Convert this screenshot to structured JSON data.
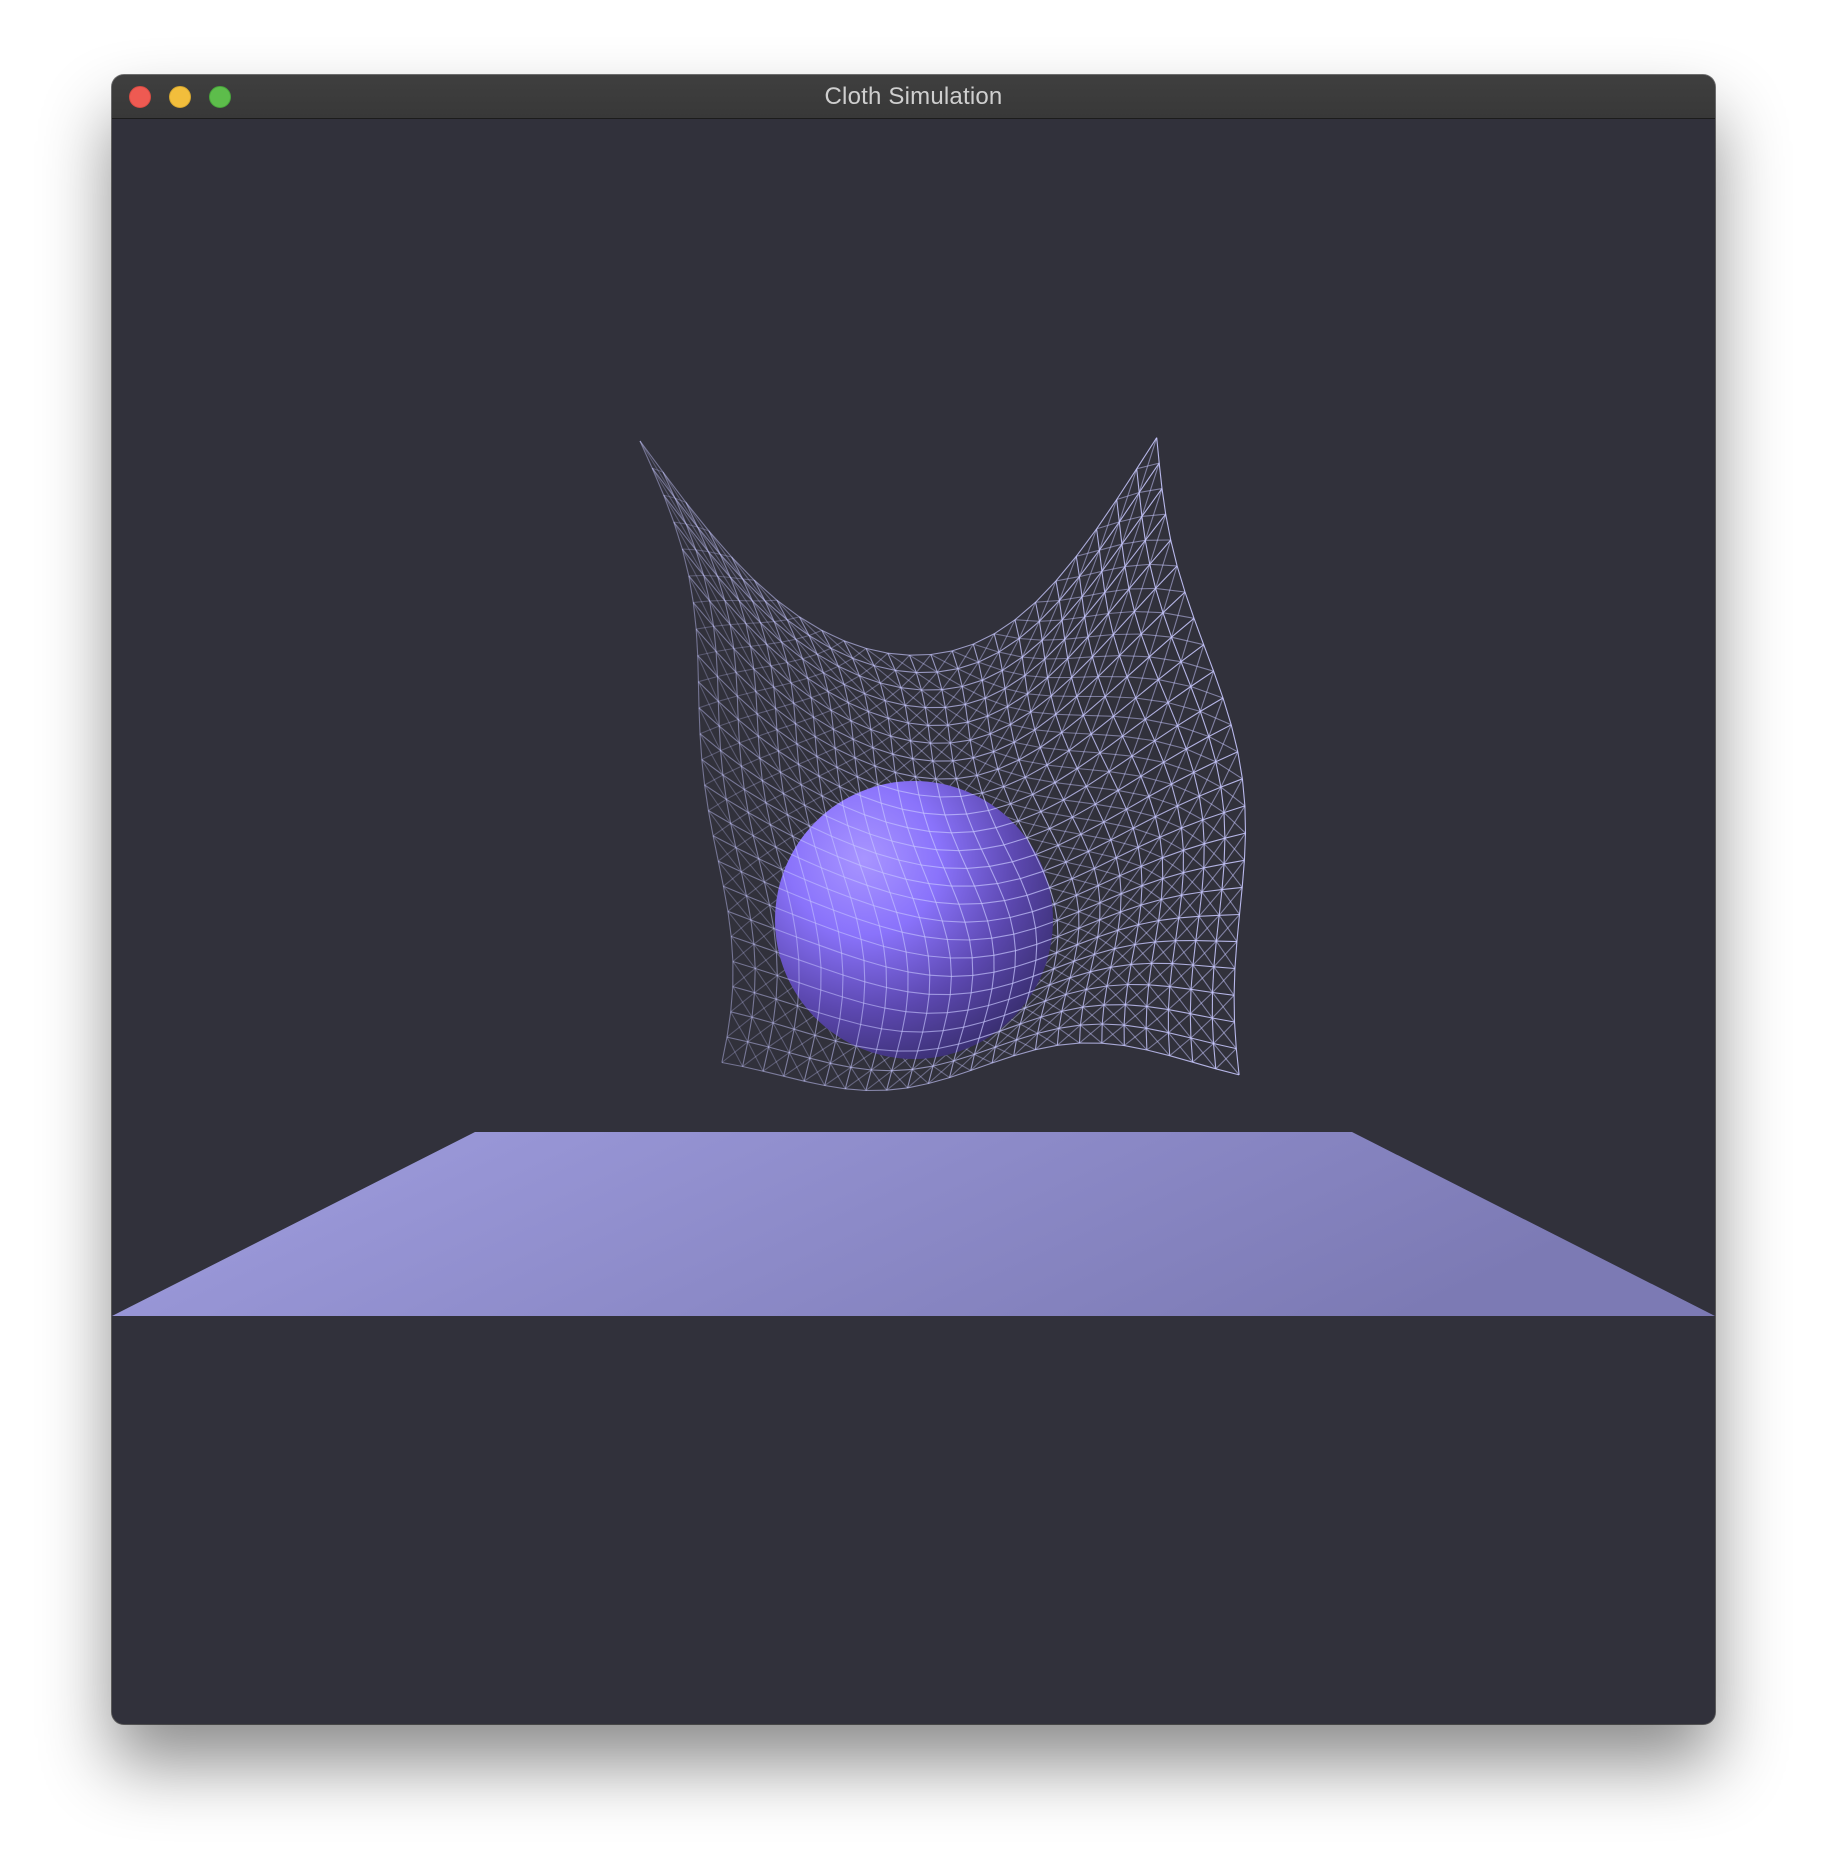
{
  "window": {
    "title": "Cloth Simulation",
    "buttons": [
      {
        "name": "close",
        "color": "#ee5a52"
      },
      {
        "name": "minimize",
        "color": "#f2be3c"
      },
      {
        "name": "maximize",
        "color": "#5dbd4b"
      }
    ]
  },
  "scene": {
    "background_color": "#31313b",
    "floor_color": "#8e8ccc",
    "sphere_color": "#8572f2",
    "cloth_color": "#c8c8ff",
    "render_mode": "wireframe"
  }
}
